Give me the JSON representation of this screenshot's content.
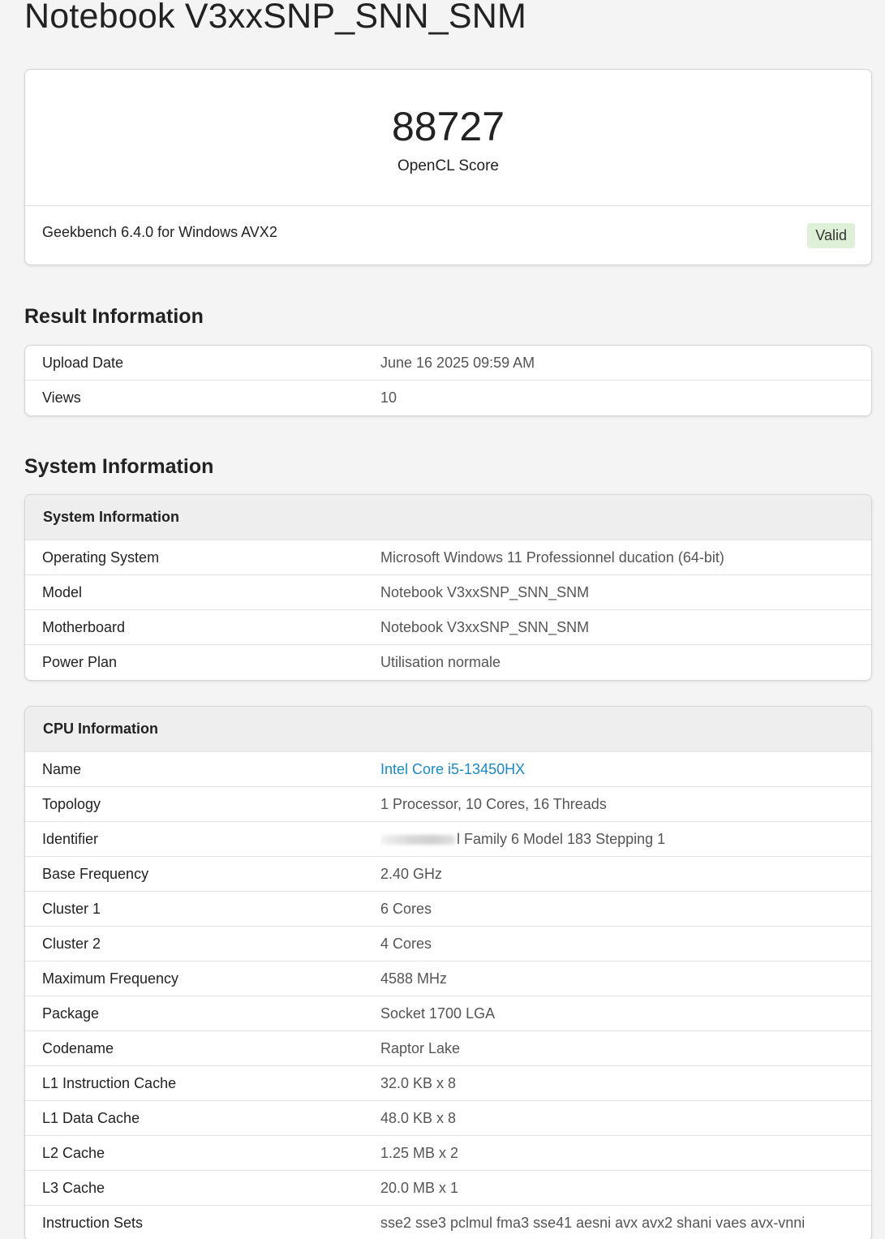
{
  "page": {
    "title": "Notebook V3xxSNP_SNN_SNM"
  },
  "score": {
    "value": "88727",
    "label": "OpenCL Score",
    "version": "Geekbench 6.4.0 for Windows AVX2",
    "status": "Valid"
  },
  "result_info": {
    "heading": "Result Information",
    "rows": [
      {
        "key": "Upload Date",
        "value": "June 16 2025 09:59 AM"
      },
      {
        "key": "Views",
        "value": "10"
      }
    ]
  },
  "system_info": {
    "heading": "System Information",
    "table_title": "System Information",
    "rows": [
      {
        "key": "Operating System",
        "value": "Microsoft Windows 11 Professionnel ducation (64-bit)"
      },
      {
        "key": "Model",
        "value": "Notebook V3xxSNP_SNN_SNM"
      },
      {
        "key": "Motherboard",
        "value": "Notebook V3xxSNP_SNN_SNM"
      },
      {
        "key": "Power Plan",
        "value": "Utilisation normale"
      }
    ]
  },
  "cpu_info": {
    "table_title": "CPU Information",
    "rows": [
      {
        "key": "Name",
        "value": "Intel Core i5-13450HX"
      },
      {
        "key": "Topology",
        "value": "1 Processor, 10 Cores, 16 Threads"
      },
      {
        "key": "Identifier",
        "value": "l Family 6 Model 183 Stepping 1"
      },
      {
        "key": "Base Frequency",
        "value": "2.40 GHz"
      },
      {
        "key": "Cluster 1",
        "value": "6 Cores"
      },
      {
        "key": "Cluster 2",
        "value": "4 Cores"
      },
      {
        "key": "Maximum Frequency",
        "value": "4588 MHz"
      },
      {
        "key": "Package",
        "value": "Socket 1700 LGA"
      },
      {
        "key": "Codename",
        "value": "Raptor Lake"
      },
      {
        "key": "L1 Instruction Cache",
        "value": "32.0 KB x 8"
      },
      {
        "key": "L1 Data Cache",
        "value": "48.0 KB x 8"
      },
      {
        "key": "L2 Cache",
        "value": "1.25 MB x 2"
      },
      {
        "key": "L3 Cache",
        "value": "20.0 MB x 1"
      },
      {
        "key": "Instruction Sets",
        "value": "sse2 sse3 pclmul fma3 sse41 aesni avx avx2 shani vaes avx-vnni"
      }
    ]
  },
  "colors": {
    "link": "#1a8bc4",
    "valid_badge_bg": "#dff0d8",
    "table_header_bg": "#eeeeee",
    "page_bg": "#f4f4f4"
  }
}
